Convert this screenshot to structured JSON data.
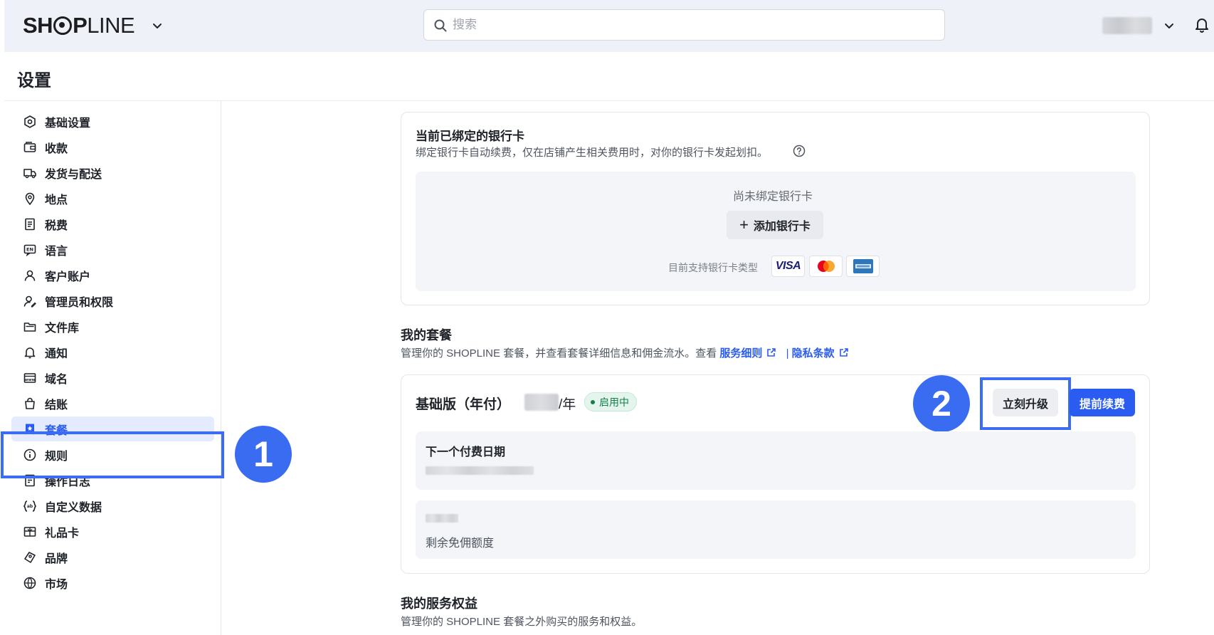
{
  "header": {
    "logo_text_bold": "SH",
    "logo_text_bold2": "P",
    "logo_text_light": "LINE",
    "search_placeholder": "搜索"
  },
  "page": {
    "title": "设置"
  },
  "sidebar": {
    "items": [
      {
        "label": "基础设置",
        "icon": "settings-hex-icon"
      },
      {
        "label": "收款",
        "icon": "wallet-icon"
      },
      {
        "label": "发货与配送",
        "icon": "truck-icon"
      },
      {
        "label": "地点",
        "icon": "location-pin-icon"
      },
      {
        "label": "税费",
        "icon": "receipt-icon"
      },
      {
        "label": "语言",
        "icon": "language-icon"
      },
      {
        "label": "客户账户",
        "icon": "user-icon"
      },
      {
        "label": "管理员和权限",
        "icon": "user-edit-icon"
      },
      {
        "label": "文件库",
        "icon": "folder-icon"
      },
      {
        "label": "通知",
        "icon": "bell-icon"
      },
      {
        "label": "域名",
        "icon": "domain-icon"
      },
      {
        "label": "结账",
        "icon": "bag-icon"
      },
      {
        "label": "套餐",
        "icon": "plan-bookmark-icon",
        "active": true
      },
      {
        "label": "规则",
        "icon": "info-icon"
      },
      {
        "label": "操作日志",
        "icon": "log-icon"
      },
      {
        "label": "自定义数据",
        "icon": "custom-data-icon"
      },
      {
        "label": "礼品卡",
        "icon": "gift-card-icon"
      },
      {
        "label": "品牌",
        "icon": "brand-icon"
      },
      {
        "label": "市场",
        "icon": "globe-icon"
      }
    ]
  },
  "bank_card": {
    "title": "当前已绑定的银行卡",
    "subtitle": "绑定银行卡自动续费，仅在店铺产生相关费用时，对你的银行卡发起划扣。",
    "empty_text": "尚未绑定银行卡",
    "add_button": "添加银行卡",
    "supported_label": "目前支持银行卡类型",
    "visa_text": "VISA"
  },
  "plan": {
    "section_title": "我的套餐",
    "section_desc": "管理你的 SHOPLINE 套餐，并查看套餐详细信息和佣金流水。查看",
    "link_terms": "服务细则",
    "link_separator": "|",
    "link_privacy": "隐私条款",
    "name": "基础版（年付）",
    "price_suffix": "/年",
    "status": "启用中",
    "upgrade_button": "立刻升级",
    "renew_button": "提前续费",
    "next_payment_label": "下一个付费日期",
    "remaining_label": "剩余免佣额度"
  },
  "services": {
    "title": "我的服务权益",
    "desc": "管理你的 SHOPLINE 套餐之外购买的服务和权益。"
  },
  "annotations": {
    "step1": "1",
    "step2": "2"
  },
  "colors": {
    "accent": "#2a5cf2",
    "highlight": "#3b6cf3",
    "success": "#13804a"
  }
}
